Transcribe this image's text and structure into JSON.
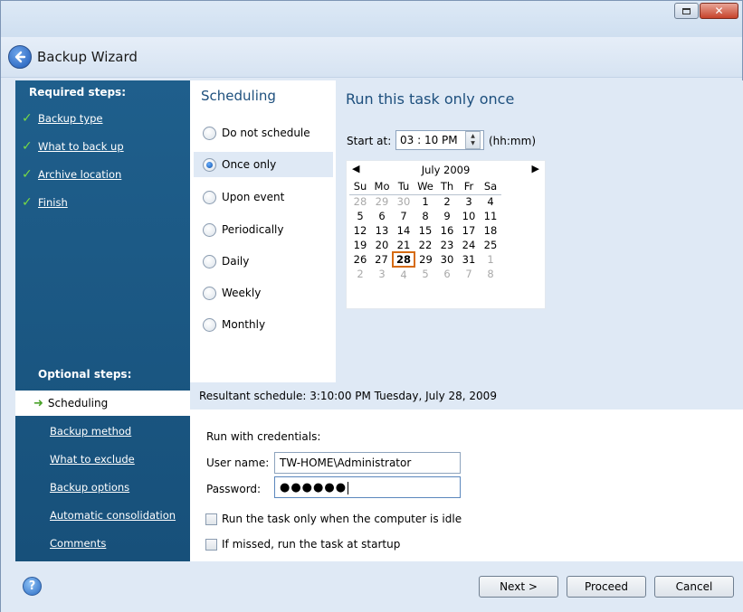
{
  "window": {
    "title": "Backup Wizard"
  },
  "sidebar": {
    "required_heading": "Required steps:",
    "required_steps": [
      {
        "label": "Backup type",
        "status_icon": "check-icon"
      },
      {
        "label": "What to back up",
        "status_icon": "check-icon"
      },
      {
        "label": "Archive location",
        "status_icon": "check-icon"
      },
      {
        "label": "Finish",
        "status_icon": "check-icon"
      }
    ],
    "optional_heading": "Optional steps:",
    "optional_steps": [
      {
        "label": "Scheduling",
        "active": true
      },
      {
        "label": "Backup method"
      },
      {
        "label": "What to exclude"
      },
      {
        "label": "Backup options"
      },
      {
        "label": "Automatic consolidation"
      },
      {
        "label": "Comments"
      }
    ]
  },
  "scheduling": {
    "title": "Scheduling",
    "options": [
      {
        "label": "Do not schedule",
        "selected": false
      },
      {
        "label": "Once only",
        "selected": true
      },
      {
        "label": "Upon event",
        "selected": false
      },
      {
        "label": "Periodically",
        "selected": false
      },
      {
        "label": "Daily",
        "selected": false
      },
      {
        "label": "Weekly",
        "selected": false
      },
      {
        "label": "Monthly",
        "selected": false
      }
    ]
  },
  "task": {
    "title": "Run this task only once",
    "start_label": "Start at:",
    "time_value": "03 : 10 PM",
    "time_format": "(hh:mm)"
  },
  "calendar": {
    "month_label": "July 2009",
    "prev_icon": "◀",
    "next_icon": "▶",
    "weekdays": [
      "Su",
      "Mo",
      "Tu",
      "We",
      "Th",
      "Fr",
      "Sa"
    ],
    "weeks": [
      [
        "28",
        "29",
        "30",
        "1",
        "2",
        "3",
        "4"
      ],
      [
        "5",
        "6",
        "7",
        "8",
        "9",
        "10",
        "11"
      ],
      [
        "12",
        "13",
        "14",
        "15",
        "16",
        "17",
        "18"
      ],
      [
        "19",
        "20",
        "21",
        "22",
        "23",
        "24",
        "25"
      ],
      [
        "26",
        "27",
        "28",
        "29",
        "30",
        "31",
        "1"
      ],
      [
        "2",
        "3",
        "4",
        "5",
        "6",
        "7",
        "8"
      ]
    ],
    "selected_day": "28"
  },
  "resultant": {
    "text": "Resultant schedule:  3:10:00 PM Tuesday, July 28, 2009"
  },
  "credentials": {
    "heading": "Run with credentials:",
    "user_label": "User name:",
    "user_value": "TW-HOME\\Administrator",
    "password_label": "Password:",
    "password_mask": "●●●●●●"
  },
  "checkboxes": [
    {
      "label": "Run the task only when the computer is idle",
      "checked": false
    },
    {
      "label": "If missed, run the task at startup",
      "checked": false
    }
  ],
  "footer": {
    "next_label": "Next >",
    "proceed_label": "Proceed",
    "cancel_label": "Cancel",
    "help_glyph": "?"
  }
}
